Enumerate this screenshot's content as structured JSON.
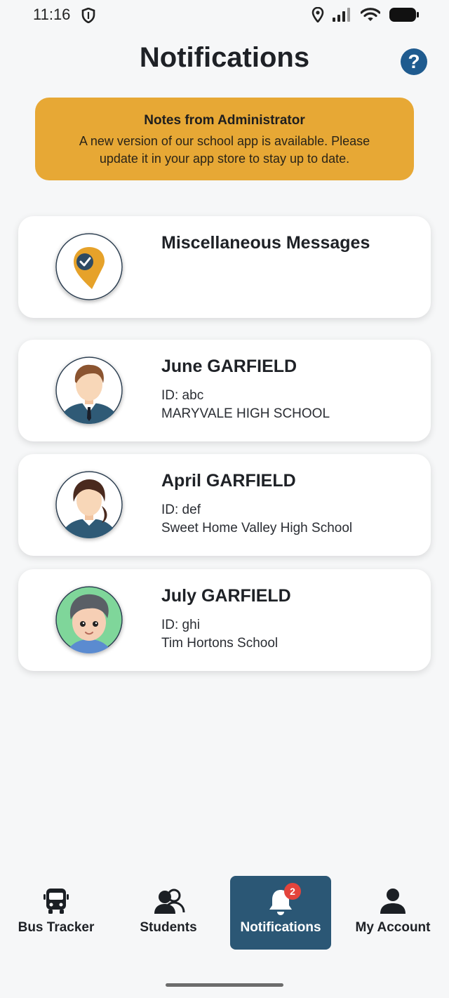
{
  "status_bar": {
    "time": "11:16"
  },
  "header": {
    "title": "Notifications",
    "help_label": "?"
  },
  "admin_banner": {
    "title": "Notes from Administrator",
    "message": "A new version of our school app is available. Please update it in your app store to stay up to date."
  },
  "cards": [
    {
      "name": "Miscellaneous Messages"
    },
    {
      "name": "June GARFIELD",
      "id": "ID: abc",
      "school": "MARYVALE HIGH SCHOOL"
    },
    {
      "name": "April GARFIELD",
      "id": "ID: def",
      "school": "Sweet Home Valley High School"
    },
    {
      "name": "July GARFIELD",
      "id": "ID: ghi",
      "school": "Tim Hortons School"
    }
  ],
  "nav": {
    "items": [
      {
        "label": "Bus Tracker",
        "icon": "bus-icon"
      },
      {
        "label": "Students",
        "icon": "students-icon"
      },
      {
        "label": "Notifications",
        "icon": "bell-icon",
        "badge": "2",
        "active": true
      },
      {
        "label": "My Account",
        "icon": "account-icon"
      }
    ]
  },
  "colors": {
    "accent": "#e7a835",
    "nav_active": "#2b5775",
    "help": "#1f5b8f",
    "badge": "#e3443c"
  }
}
